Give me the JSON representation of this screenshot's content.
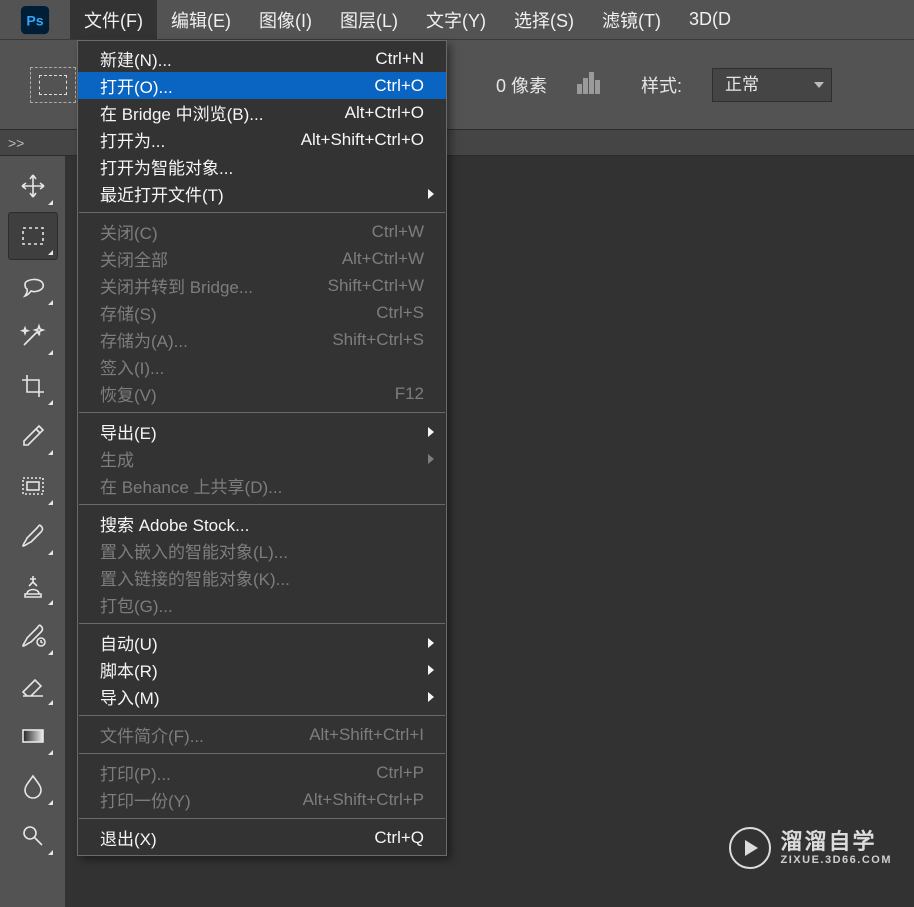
{
  "menubar": {
    "items": [
      {
        "label": "文件(F)",
        "open": true
      },
      {
        "label": "编辑(E)"
      },
      {
        "label": "图像(I)"
      },
      {
        "label": "图层(L)"
      },
      {
        "label": "文字(Y)"
      },
      {
        "label": "选择(S)"
      },
      {
        "label": "滤镜(T)"
      },
      {
        "label": "3D(D"
      }
    ]
  },
  "optionsbar": {
    "pixels_suffix": "0 像素",
    "style_label": "样式:",
    "style_value": "正常"
  },
  "tabstrip": {
    "chevrons": ">>"
  },
  "dropdown": {
    "groups": [
      [
        {
          "label": "新建(N)...",
          "shortcut": "Ctrl+N"
        },
        {
          "label": "打开(O)...",
          "shortcut": "Ctrl+O",
          "highlight": true
        },
        {
          "label": "在 Bridge 中浏览(B)...",
          "shortcut": "Alt+Ctrl+O"
        },
        {
          "label": "打开为...",
          "shortcut": "Alt+Shift+Ctrl+O"
        },
        {
          "label": "打开为智能对象..."
        },
        {
          "label": "最近打开文件(T)",
          "submenu": true
        }
      ],
      [
        {
          "label": "关闭(C)",
          "shortcut": "Ctrl+W",
          "disabled": true
        },
        {
          "label": "关闭全部",
          "shortcut": "Alt+Ctrl+W",
          "disabled": true
        },
        {
          "label": "关闭并转到 Bridge...",
          "shortcut": "Shift+Ctrl+W",
          "disabled": true
        },
        {
          "label": "存储(S)",
          "shortcut": "Ctrl+S",
          "disabled": true
        },
        {
          "label": "存储为(A)...",
          "shortcut": "Shift+Ctrl+S",
          "disabled": true
        },
        {
          "label": "签入(I)...",
          "disabled": true
        },
        {
          "label": "恢复(V)",
          "shortcut": "F12",
          "disabled": true
        }
      ],
      [
        {
          "label": "导出(E)",
          "submenu": true
        },
        {
          "label": "生成",
          "submenu": true,
          "disabled": true
        },
        {
          "label": "在 Behance 上共享(D)...",
          "disabled": true
        }
      ],
      [
        {
          "label": "搜索 Adobe Stock..."
        },
        {
          "label": "置入嵌入的智能对象(L)...",
          "disabled": true
        },
        {
          "label": "置入链接的智能对象(K)...",
          "disabled": true
        },
        {
          "label": "打包(G)...",
          "disabled": true
        }
      ],
      [
        {
          "label": "自动(U)",
          "submenu": true
        },
        {
          "label": "脚本(R)",
          "submenu": true
        },
        {
          "label": "导入(M)",
          "submenu": true
        }
      ],
      [
        {
          "label": "文件简介(F)...",
          "shortcut": "Alt+Shift+Ctrl+I",
          "disabled": true
        }
      ],
      [
        {
          "label": "打印(P)...",
          "shortcut": "Ctrl+P",
          "disabled": true
        },
        {
          "label": "打印一份(Y)",
          "shortcut": "Alt+Shift+Ctrl+P",
          "disabled": true
        }
      ],
      [
        {
          "label": "退出(X)",
          "shortcut": "Ctrl+Q"
        }
      ]
    ]
  },
  "tools": [
    {
      "name": "move-tool"
    },
    {
      "name": "marquee-tool",
      "active": true
    },
    {
      "name": "lasso-tool"
    },
    {
      "name": "magic-wand-tool"
    },
    {
      "name": "crop-tool"
    },
    {
      "name": "eyedropper-tool"
    },
    {
      "name": "frame-tool"
    },
    {
      "name": "brush-tool"
    },
    {
      "name": "clone-stamp-tool"
    },
    {
      "name": "history-brush-tool"
    },
    {
      "name": "eraser-tool"
    },
    {
      "name": "gradient-tool"
    },
    {
      "name": "blur-tool"
    },
    {
      "name": "dodge-tool"
    }
  ],
  "watermark": {
    "main": "溜溜自学",
    "sub": "ZIXUE.3D66.COM"
  }
}
